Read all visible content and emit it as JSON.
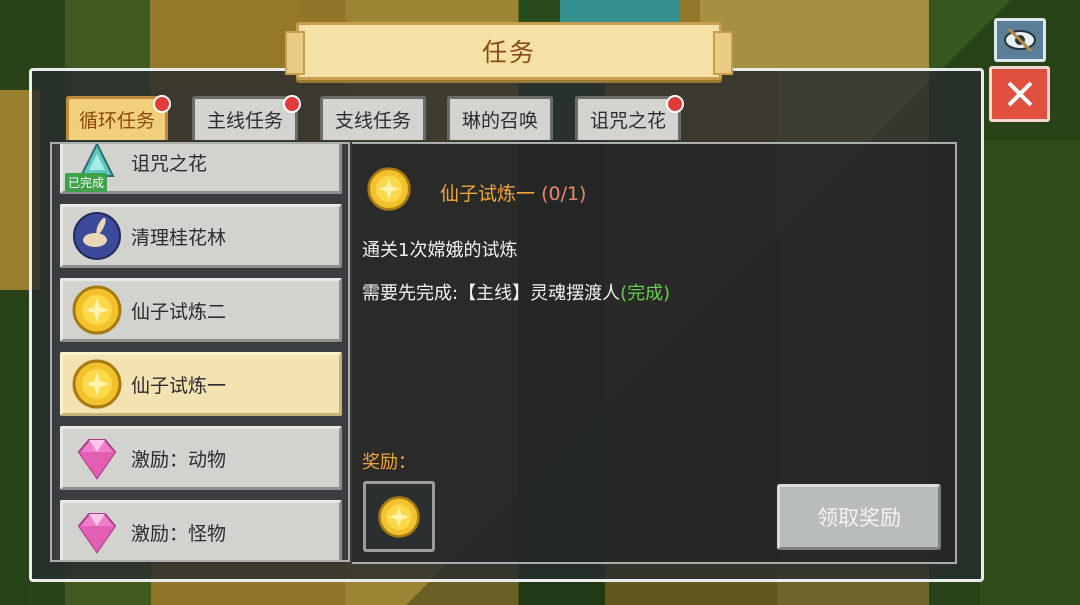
{
  "window": {
    "title": "任务"
  },
  "tabs": [
    {
      "label": "循环任务",
      "active": true,
      "has_dot": true
    },
    {
      "label": "主线任务",
      "active": false,
      "has_dot": true
    },
    {
      "label": "支线任务",
      "active": false,
      "has_dot": false
    },
    {
      "label": "琳的召唤",
      "active": false,
      "has_dot": false
    },
    {
      "label": "诅咒之花",
      "active": false,
      "has_dot": true
    }
  ],
  "quest_list": [
    {
      "label": "诅咒之花",
      "icon": "flower-crystal-icon",
      "badge": "已完成",
      "selected": false
    },
    {
      "label": "清理桂花林",
      "icon": "rabbit-orb-icon",
      "badge": "",
      "selected": false
    },
    {
      "label": "仙子试炼二",
      "icon": "gold-coin-icon",
      "badge": "",
      "selected": false
    },
    {
      "label": "仙子试炼一",
      "icon": "gold-coin-icon",
      "badge": "",
      "selected": true
    },
    {
      "label": "激励：动物",
      "icon": "pink-gem-icon",
      "badge": "",
      "selected": false
    },
    {
      "label": "激励：怪物",
      "icon": "pink-gem-icon",
      "badge": "",
      "selected": false
    }
  ],
  "detail": {
    "title": "仙子试炼一",
    "progress": "(0/1)",
    "description": "通关1次嫦娥的试炼",
    "prerequisite_prefix": "需要先完成:【主线】灵魂摆渡人",
    "prerequisite_status": "(完成)",
    "reward_label": "奖励：",
    "reward_icon": "gold-coin-icon",
    "claim_button": "领取奖励"
  },
  "colors": {
    "accent_orange": "#f0a43c",
    "done_green": "#66cc55",
    "close_red": "#e0503e",
    "active_tab": "#f2cf7a"
  }
}
